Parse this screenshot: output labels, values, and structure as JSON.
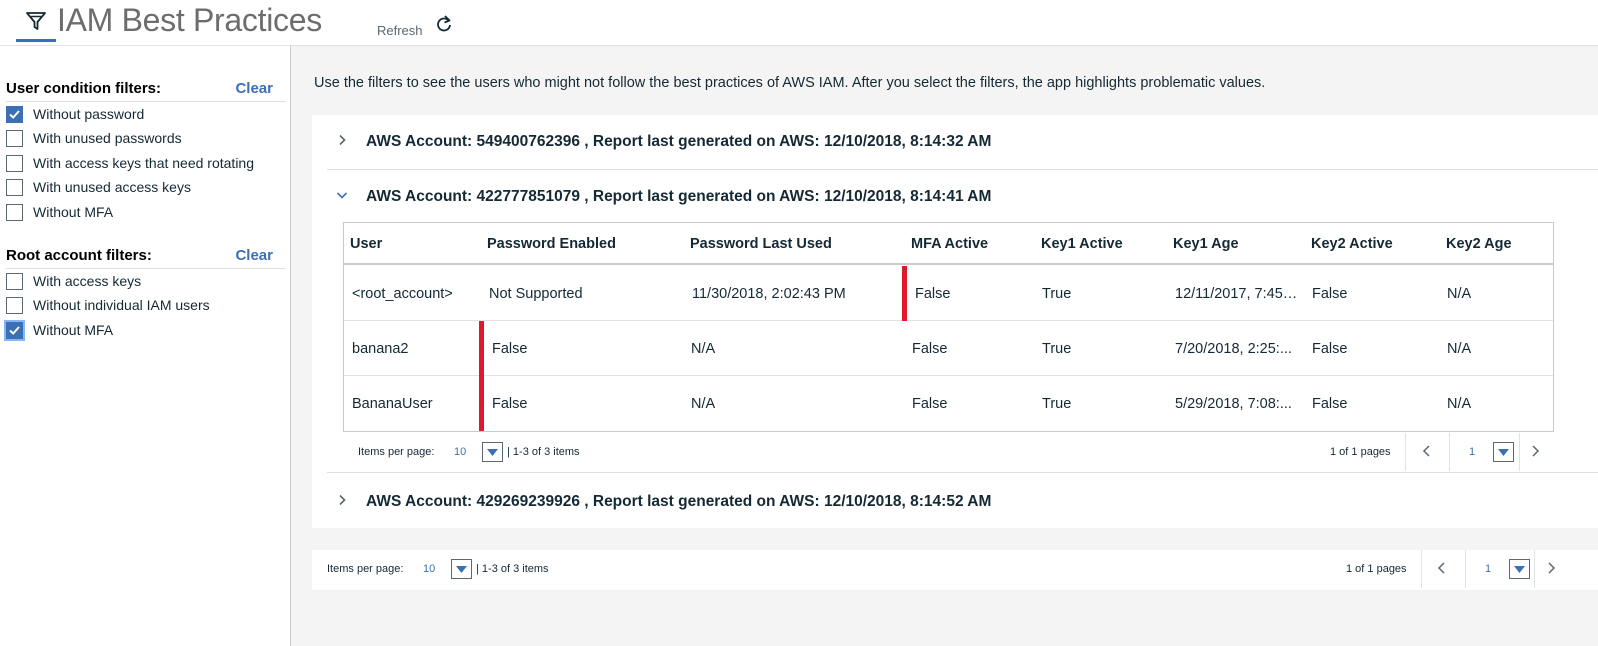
{
  "header": {
    "title": "IAM Best Practices",
    "refresh_label": "Refresh"
  },
  "sidebar": {
    "user_filters": {
      "title": "User condition filters:",
      "clear_label": "Clear",
      "items": [
        {
          "label": "Without password",
          "checked": true
        },
        {
          "label": "With unused passwords",
          "checked": false
        },
        {
          "label": "With access keys that need rotating",
          "checked": false
        },
        {
          "label": "With unused access keys",
          "checked": false
        },
        {
          "label": "Without MFA",
          "checked": false
        }
      ]
    },
    "root_filters": {
      "title": "Root account filters:",
      "clear_label": "Clear",
      "items": [
        {
          "label": "With access keys",
          "checked": false
        },
        {
          "label": "Without individual IAM users",
          "checked": false
        },
        {
          "label": "Without MFA",
          "checked": true
        }
      ]
    }
  },
  "main": {
    "description": "Use the filters to see the users who might not follow the best practices of AWS IAM. After you select the filters, the app highlights problematic values.",
    "accounts": [
      {
        "title": "AWS Account: 549400762396 , Report last generated on AWS: 12/10/2018, 8:14:32 AM",
        "expanded": false
      },
      {
        "title": "AWS Account: 422777851079 , Report last generated on AWS: 12/10/2018, 8:14:41 AM",
        "expanded": true
      },
      {
        "title": "AWS Account: 429269239926 , Report last generated on AWS: 12/10/2018, 8:14:52 AM",
        "expanded": false
      }
    ],
    "table": {
      "columns": [
        "User",
        "Password Enabled",
        "Password Last Used",
        "MFA Active",
        "Key1 Active",
        "Key1 Age",
        "Key2 Active",
        "Key2 Age"
      ],
      "rows": [
        {
          "cells": [
            "<root_account>",
            "Not Supported",
            "11/30/2018, 2:02:43 PM",
            "False",
            "True",
            "12/11/2017, 7:45:5...",
            "False",
            "N/A"
          ],
          "flag_column": 3
        },
        {
          "cells": [
            "banana2",
            "False",
            "N/A",
            "False",
            "True",
            "7/20/2018, 2:25:...",
            "False",
            "N/A"
          ],
          "flag_column": 1
        },
        {
          "cells": [
            "BananaUser",
            "False",
            "N/A",
            "False",
            "True",
            "5/29/2018, 7:08:...",
            "False",
            "N/A"
          ],
          "flag_column": 1
        }
      ],
      "flag_color": "#e0182d"
    },
    "inner_pager": {
      "items_per_page_label": "Items per page:",
      "items_per_page": "10",
      "range": "|  1-3 of 3 items",
      "pages": "1 of 1 pages",
      "page": "1"
    },
    "outer_pager": {
      "items_per_page_label": "Items per page:",
      "items_per_page": "10",
      "range": "|  1-3 of 3 items",
      "pages": "1 of 1 pages",
      "page": "1"
    }
  },
  "colors": {
    "accent": "#3d70b2",
    "flag": "#e0182d"
  }
}
